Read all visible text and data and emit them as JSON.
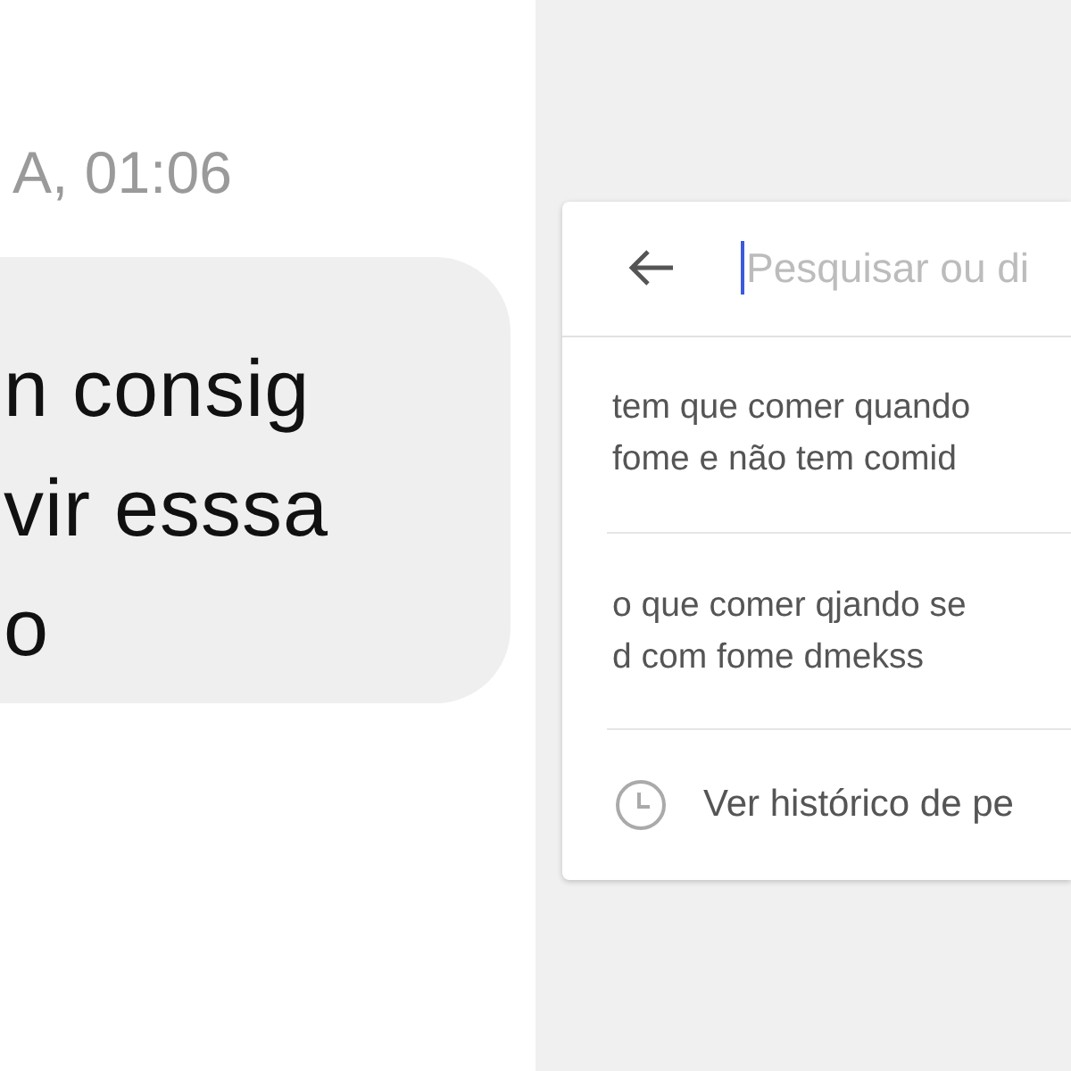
{
  "timestamp": "A, 01:06",
  "message": {
    "text": "n consig\nvir esssa\no"
  },
  "search": {
    "placeholder": "Pesquisar ou di",
    "focused": true
  },
  "suggestions": [
    {
      "text": "tem que comer quando\nfome e não tem comid"
    },
    {
      "text": "o que comer qjando se\nd com fome dmekss"
    }
  ],
  "history_link": "Ver histórico de pe"
}
